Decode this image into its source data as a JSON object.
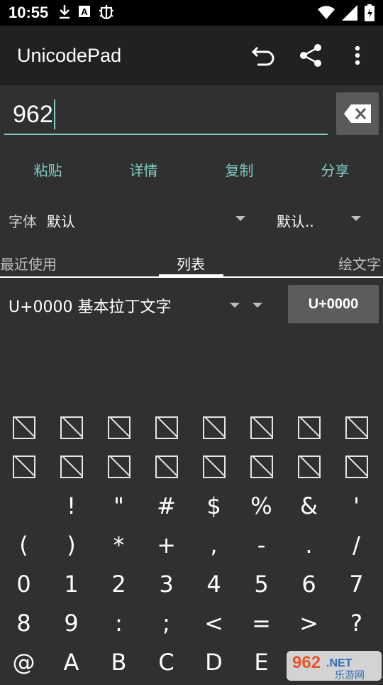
{
  "status_bar": {
    "time": "10:55",
    "icons": [
      "download-icon",
      "a-icon",
      "bug-icon"
    ],
    "right_icons": [
      "wifi-icon",
      "signal-icon",
      "battery-icon"
    ]
  },
  "app_bar": {
    "title": "UnicodePad",
    "actions": [
      "undo-icon",
      "share-icon",
      "more-icon"
    ]
  },
  "input": {
    "value": "962"
  },
  "actions": {
    "paste": "粘贴",
    "details": "详情",
    "copy": "复制",
    "share": "分享"
  },
  "font_row": {
    "label": "字体",
    "font_value": "默认",
    "second_value": "默认.."
  },
  "tabs": {
    "recent": "最近使用",
    "list": "列表",
    "emoji": "绘文字"
  },
  "block_row": {
    "block_name": "U+0000 基本拉丁文字",
    "code_button": "U+0000"
  },
  "grid": {
    "rows": [
      [
        "□",
        "□",
        "□",
        "□",
        "□",
        "□",
        "□",
        "□"
      ],
      [
        "□",
        "□",
        "□",
        "□",
        "□",
        "□",
        "□",
        "□"
      ],
      [
        "",
        "!",
        "\"",
        "#",
        "$",
        "%",
        "&",
        "'"
      ],
      [
        "(",
        ")",
        "*",
        "+",
        ",",
        "-",
        ".",
        "/"
      ],
      [
        "0",
        "1",
        "2",
        "3",
        "4",
        "5",
        "6",
        "7"
      ],
      [
        "8",
        "9",
        ":",
        ";",
        "<",
        "=",
        ">",
        "?"
      ],
      [
        "@",
        "A",
        "B",
        "C",
        "D",
        "E",
        "",
        ""
      ]
    ]
  },
  "watermark": {
    "text_top": "962.NET",
    "text_bottom": "乐游网"
  },
  "colors": {
    "accent": "#80cbc4",
    "background": "#303030",
    "app_bar": "#212121",
    "status_bar": "#000000"
  }
}
